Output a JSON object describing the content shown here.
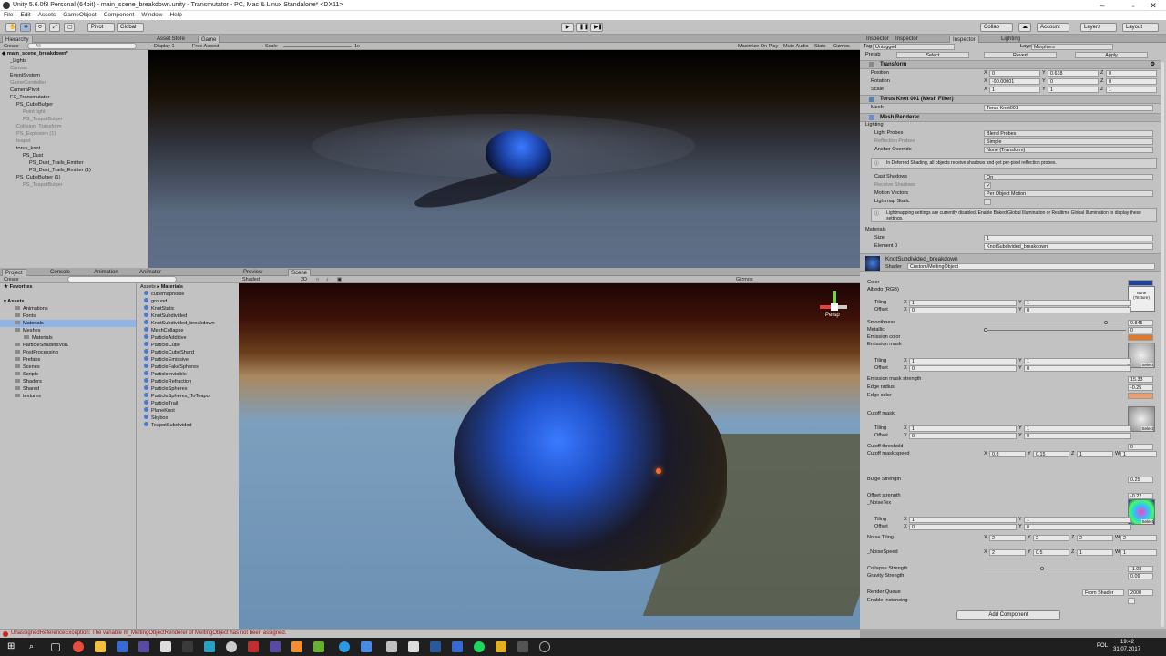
{
  "window": {
    "title": "Unity 5.6.0f3 Personal (64bit) - main_scene_breakdown.unity - Transmutator - PC, Mac & Linux Standalone* <DX11>"
  },
  "menu": [
    "File",
    "Edit",
    "Assets",
    "GameObject",
    "Component",
    "Window",
    "Help"
  ],
  "toolbar": {
    "pivot": "Pivot",
    "global": "Global",
    "collab": "Collab",
    "account": "Account",
    "layers": "Layers",
    "layout": "Layout"
  },
  "hierarchy": {
    "tab": "Hierarchy",
    "create": "Create",
    "search": "All",
    "scene": "main_scene_breakdown*",
    "items": [
      {
        "label": "_Lights",
        "indent": 1,
        "dim": false
      },
      {
        "label": "Canvas",
        "indent": 1,
        "dim": true
      },
      {
        "label": "EventSystem",
        "indent": 1,
        "dim": false
      },
      {
        "label": "GameController",
        "indent": 1,
        "dim": true
      },
      {
        "label": "CameraPivot",
        "indent": 1,
        "dim": false
      },
      {
        "label": "FX_Transmutator",
        "indent": 1,
        "dim": false
      },
      {
        "label": "PS_CubeBulger",
        "indent": 2,
        "dim": false
      },
      {
        "label": "Point light",
        "indent": 3,
        "dim": true
      },
      {
        "label": "PS_TeapotBulger",
        "indent": 3,
        "dim": true
      },
      {
        "label": "Collision_Transform",
        "indent": 2,
        "dim": true
      },
      {
        "label": "PS_Explosion (1)",
        "indent": 2,
        "dim": true
      },
      {
        "label": "teapot",
        "indent": 2,
        "dim": true
      },
      {
        "label": "torus_knot",
        "indent": 2,
        "dim": false
      },
      {
        "label": "PS_Dust",
        "indent": 3,
        "dim": false
      },
      {
        "label": "PS_Dust_Trails_Emitter",
        "indent": 4,
        "dim": false
      },
      {
        "label": "PS_Dust_Trails_Emitter (1)",
        "indent": 4,
        "dim": false
      },
      {
        "label": "PS_CubeBulger (1)",
        "indent": 2,
        "dim": false
      },
      {
        "label": "PS_TeapotBulger",
        "indent": 3,
        "dim": true
      }
    ]
  },
  "game": {
    "tabs": [
      "Asset Store",
      "Game"
    ],
    "display": "Display 1",
    "aspect": "Free Aspect",
    "scale": "Scale",
    "scale_value": "1x",
    "right_items": [
      "Maximize On Play",
      "Mute Audio",
      "Stats",
      "Gizmos"
    ]
  },
  "project": {
    "tabs": [
      "Project",
      "Console",
      "Animation",
      "Animator"
    ],
    "create": "Create",
    "favorites": "Favorites",
    "assets": "Assets",
    "folders": [
      {
        "label": "Animations",
        "indent": 1
      },
      {
        "label": "Fonts",
        "indent": 1
      },
      {
        "label": "Materials",
        "indent": 1,
        "sel": true
      },
      {
        "label": "Meshes",
        "indent": 1
      },
      {
        "label": "Materials",
        "indent": 2
      },
      {
        "label": "ParticleShadersVol1",
        "indent": 1
      },
      {
        "label": "PostProcessing",
        "indent": 1
      },
      {
        "label": "Prefabs",
        "indent": 1
      },
      {
        "label": "Scenes",
        "indent": 1
      },
      {
        "label": "Scripts",
        "indent": 1
      },
      {
        "label": "Shaders",
        "indent": 1
      },
      {
        "label": "Shared",
        "indent": 1
      },
      {
        "label": "textures",
        "indent": 1
      }
    ],
    "breadcrumb": [
      "Assets",
      "Materials"
    ],
    "materials": [
      "cubemapnoise",
      "ground",
      "KnotStatic",
      "KnotSubdivided",
      "KnotSubdivided_breakdown",
      "MeshCollapse",
      "ParticleAdditive",
      "ParticleCube",
      "ParticleCubeShard",
      "ParticleEmissive",
      "ParticleFakeSpheres",
      "ParticleInvisible",
      "ParticleRefraction",
      "ParticleSpheres",
      "ParticleSpheres_ToTeapot",
      "ParticleTrail",
      "PlaneKnot",
      "Skybox",
      "TeapotSubdivided"
    ]
  },
  "scene": {
    "tabs": [
      "Preview",
      "Scene"
    ],
    "shading": "Shaded",
    "mode2d": "2D",
    "gizmos": "Gizmos",
    "persp": "Persp"
  },
  "inspector": {
    "tabs": [
      "Inspector",
      "Inspector",
      "Inspector",
      "Lighting"
    ],
    "tag_label": "Tag",
    "tag": "Untagged",
    "layer_label": "Layer",
    "layer": "Morphers",
    "prefab": "Prefab",
    "prefab_buttons": [
      "Select",
      "Revert",
      "Apply"
    ],
    "transform": {
      "title": "Transform",
      "rows": [
        {
          "label": "Position",
          "x": "0",
          "y": "0.618",
          "z": "0"
        },
        {
          "label": "Rotation",
          "x": "-90.00001",
          "y": "0",
          "z": "0"
        },
        {
          "label": "Scale",
          "x": "1",
          "y": "1",
          "z": "1"
        }
      ]
    },
    "meshfilter": {
      "title": "Torus Knot 001 (Mesh Filter)",
      "mesh_label": "Mesh",
      "mesh": "Torus Knot001"
    },
    "meshrenderer": {
      "title": "Mesh Renderer",
      "lighting": "Lighting",
      "rows": [
        {
          "label": "Light Probes",
          "value": "Blend Probes"
        },
        {
          "label": "Reflection Probes",
          "value": "Simple"
        },
        {
          "label": "Anchor Override",
          "value": "None (Transform)"
        }
      ],
      "info1": "In Deferred Shading, all objects receive shadows and get per-pixel reflection probes.",
      "rows2": [
        {
          "label": "Cast Shadows",
          "value": "On"
        },
        {
          "label": "Receive Shadows",
          "value": "✓"
        },
        {
          "label": "Motion Vectors",
          "value": "Per Object Motion"
        },
        {
          "label": "Lightmap Static",
          "value": ""
        }
      ],
      "info2": "Lightmapping settings are currently disabled. Enable Baked Global Illumination or Realtime Global Illumination to display these settings.",
      "materials_label": "Materials",
      "size_label": "Size",
      "size": "1",
      "element_label": "Element 0",
      "element": "KnotSubdivided_breakdown"
    },
    "material": {
      "name": "KnotSubdivided_breakdown",
      "shader_label": "Shader",
      "shader": "Custom/MeltingObject",
      "color": "Color",
      "albedo": "Albedo (RGB)",
      "none_texture": "None (Texture)",
      "tiling": "Tiling",
      "offset": "Offset",
      "select": "Select",
      "smoothness": "Smoothness",
      "smoothness_v": "0.845",
      "metallic": "Metallic",
      "metallic_v": "0",
      "emission_color": "Emission color",
      "emission_mask": "Emission mask",
      "ems_strength": "Emission mask strength",
      "ems_strength_v": "15.33",
      "edge_radius": "Edge radius",
      "edge_radius_v": "-0.25",
      "edge_color": "Edge color",
      "cutoff_mask": "Cutoff mask",
      "cutoff_threshold": "Cutoff threshold",
      "cutoff_threshold_v": "0",
      "cutoff_speed": "Cutoff mask speed",
      "cutoff_speed_v": {
        "x": "0.8",
        "y": "0.15",
        "z": "1",
        "w": "1"
      },
      "bulge": "Bulge Strength",
      "bulge_v": "0.25",
      "offset_strength": "Offset strength",
      "offset_strength_v": "-0.22",
      "noisetex": "_NoiseTex",
      "noise_tiling": "Noise Tiling",
      "noise_tiling_v": {
        "x": "2",
        "y": "2",
        "z": "2",
        "w": "2"
      },
      "noise_speed": "_NoiseSpeed",
      "noise_speed_v": {
        "x": "2",
        "y": "0.5",
        "z": "1",
        "w": "1"
      },
      "collapse": "Collapse Strength",
      "collapse_v": "-1.08",
      "gravity": "Gravity Strength",
      "gravity_v": "0.09",
      "render_queue": "Render Queue",
      "render_queue_mode": "From Shader",
      "render_queue_v": "2000",
      "instancing": "Enable Instancing"
    },
    "add_component": "Add Component"
  },
  "status": {
    "error": "UnassignedReferenceException: The variable m_MeltingObjectRenderer of MeltingObject has not been assigned."
  },
  "taskbar": {
    "lang": "POL",
    "time": "19:42",
    "date": "31.07.2017"
  }
}
